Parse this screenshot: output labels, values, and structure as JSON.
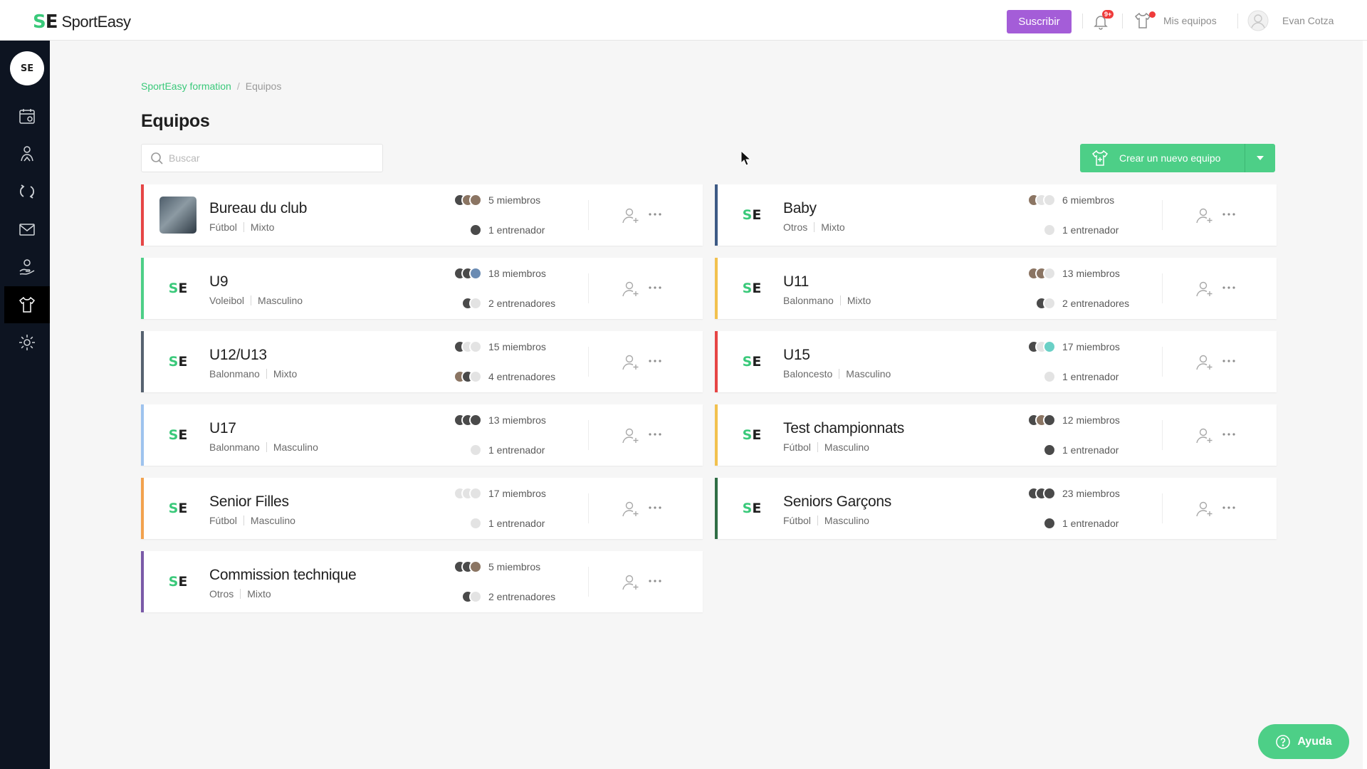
{
  "brand": {
    "mark_s": "S",
    "mark_e": "E",
    "name": "SportEasy"
  },
  "topbar": {
    "subscribe_label": "Suscribir",
    "notifications_badge": "9+",
    "my_teams_label": "Mis equipos",
    "user_name": "Evan Cotza"
  },
  "sidebar": {
    "logo_text": "SE",
    "items": [
      {
        "icon": "calendar-icon"
      },
      {
        "icon": "members-icon"
      },
      {
        "icon": "exchange-icon"
      },
      {
        "icon": "mail-icon"
      },
      {
        "icon": "hand-icon"
      },
      {
        "icon": "jersey-icon",
        "active": true
      },
      {
        "icon": "gear-icon"
      }
    ]
  },
  "breadcrumb": {
    "root": "SportEasy formation",
    "separator": "/",
    "current": "Equipos"
  },
  "page": {
    "title": "Equipos"
  },
  "search": {
    "placeholder": "Buscar",
    "value": ""
  },
  "create_button": {
    "label": "Crear un nuevo equipo"
  },
  "colors": {
    "accent": "#4dcf87",
    "brand_green": "#3ac97a",
    "subscribe": "#a45dd8",
    "sidebar_bg": "#0d1421"
  },
  "teams": [
    {
      "name": "Bureau du club",
      "sport": "Fútbol",
      "gender": "Mixto",
      "members": "5 miembros",
      "coaches": "1 entrenador",
      "color": "#e64545",
      "photo": true,
      "member_faces": [
        "d",
        "m",
        "m"
      ],
      "coach_faces": [
        "d"
      ]
    },
    {
      "name": "Baby",
      "sport": "Otros",
      "gender": "Mixto",
      "members": "6 miembros",
      "coaches": "1 entrenador",
      "color": "#3d5a85",
      "member_faces": [
        "m",
        "g",
        "g"
      ],
      "coach_faces": [
        "g"
      ]
    },
    {
      "name": "U9",
      "sport": "Voleibol",
      "gender": "Masculino",
      "members": "18 miembros",
      "coaches": "2 entrenadores",
      "color": "#4dcf87",
      "member_faces": [
        "d",
        "d",
        "b"
      ],
      "coach_faces": [
        "d",
        "g"
      ]
    },
    {
      "name": "U11",
      "sport": "Balonmano",
      "gender": "Mixto",
      "members": "13 miembros",
      "coaches": "2 entrenadores",
      "color": "#f2c14e",
      "member_faces": [
        "m",
        "m",
        "g"
      ],
      "coach_faces": [
        "d",
        "g"
      ]
    },
    {
      "name": "U12/U13",
      "sport": "Balonmano",
      "gender": "Mixto",
      "members": "15 miembros",
      "coaches": "4 entrenadores",
      "color": "#566270",
      "member_faces": [
        "d",
        "g",
        "g"
      ],
      "coach_faces": [
        "m",
        "d",
        "g"
      ]
    },
    {
      "name": "U15",
      "sport": "Baloncesto",
      "gender": "Masculino",
      "members": "17 miembros",
      "coaches": "1 entrenador",
      "color": "#e64545",
      "member_faces": [
        "d",
        "g",
        "t"
      ],
      "coach_faces": [
        "g"
      ]
    },
    {
      "name": "U17",
      "sport": "Balonmano",
      "gender": "Masculino",
      "members": "13 miembros",
      "coaches": "1 entrenador",
      "color": "#9ec3ee",
      "member_faces": [
        "d",
        "d",
        "d"
      ],
      "coach_faces": [
        "g"
      ]
    },
    {
      "name": "Test championnats",
      "sport": "Fútbol",
      "gender": "Masculino",
      "members": "12 miembros",
      "coaches": "1 entrenador",
      "color": "#f2c14e",
      "member_faces": [
        "d",
        "m",
        "d"
      ],
      "coach_faces": [
        "d"
      ]
    },
    {
      "name": "Senior Filles",
      "sport": "Fútbol",
      "gender": "Masculino",
      "members": "17 miembros",
      "coaches": "1 entrenador",
      "color": "#f2a24e",
      "member_faces": [
        "g",
        "g",
        "g"
      ],
      "coach_faces": [
        "g"
      ]
    },
    {
      "name": "Seniors Garçons",
      "sport": "Fútbol",
      "gender": "Masculino",
      "members": "23 miembros",
      "coaches": "1 entrenador",
      "color": "#2f6e45",
      "member_faces": [
        "d",
        "d",
        "d"
      ],
      "coach_faces": [
        "d"
      ]
    },
    {
      "name": "Commission technique",
      "sport": "Otros",
      "gender": "Mixto",
      "members": "5 miembros",
      "coaches": "2 entrenadores",
      "color": "#7a5aa8",
      "member_faces": [
        "d",
        "d",
        "m"
      ],
      "coach_faces": [
        "d",
        "g"
      ]
    }
  ],
  "help": {
    "label": "Ayuda"
  }
}
